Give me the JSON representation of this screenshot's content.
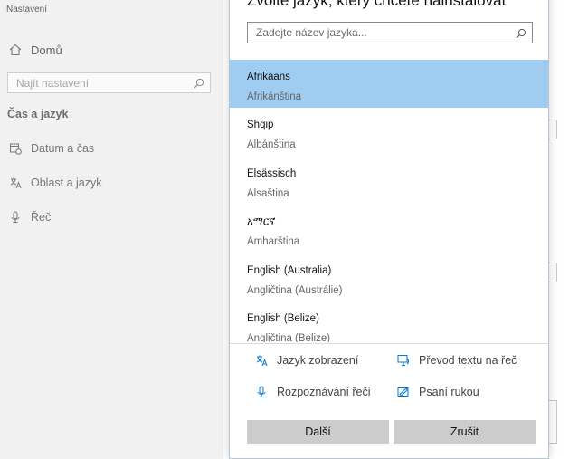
{
  "app": {
    "title": "Nastavení"
  },
  "sidebar": {
    "home_label": "Domů",
    "search_placeholder": "Najít nastavení",
    "section_title": "Čas a jazyk",
    "items": [
      {
        "label": "Datum a čas",
        "icon": "calendar-clock-icon"
      },
      {
        "label": "Oblast a jazyk",
        "icon": "language-icon"
      },
      {
        "label": "Řeč",
        "icon": "microphone-icon"
      }
    ]
  },
  "dialog": {
    "title": "Zvolte jazyk, který chcete nainstalovat",
    "search_placeholder": "Zadejte název jazyka...",
    "languages": [
      {
        "native": "Afrikaans",
        "czech": "Afrikánština",
        "selected": true
      },
      {
        "native": "Shqip",
        "czech": "Albánština",
        "selected": false
      },
      {
        "native": "Elsässisch",
        "czech": "Alsaština",
        "selected": false
      },
      {
        "native": "አማርኛ",
        "czech": "Amharština",
        "selected": false
      },
      {
        "native": "English (Australia)",
        "czech": "Angličtina (Austrálie)",
        "selected": false
      },
      {
        "native": "English (Belize)",
        "czech": "Angličtina (Belize)",
        "selected": false
      }
    ],
    "features": {
      "display_language": "Jazyk zobrazení",
      "text_to_speech": "Převod textu na řeč",
      "speech_recognition": "Rozpoznávání řeči",
      "handwriting": "Psaní rukou"
    },
    "buttons": {
      "next": "Další",
      "cancel": "Zrušit"
    }
  },
  "colors": {
    "selection": "#9fcdf2",
    "accent": "#0078d7",
    "button": "#cccccc",
    "sidebar_bg": "#f1f1f1"
  }
}
